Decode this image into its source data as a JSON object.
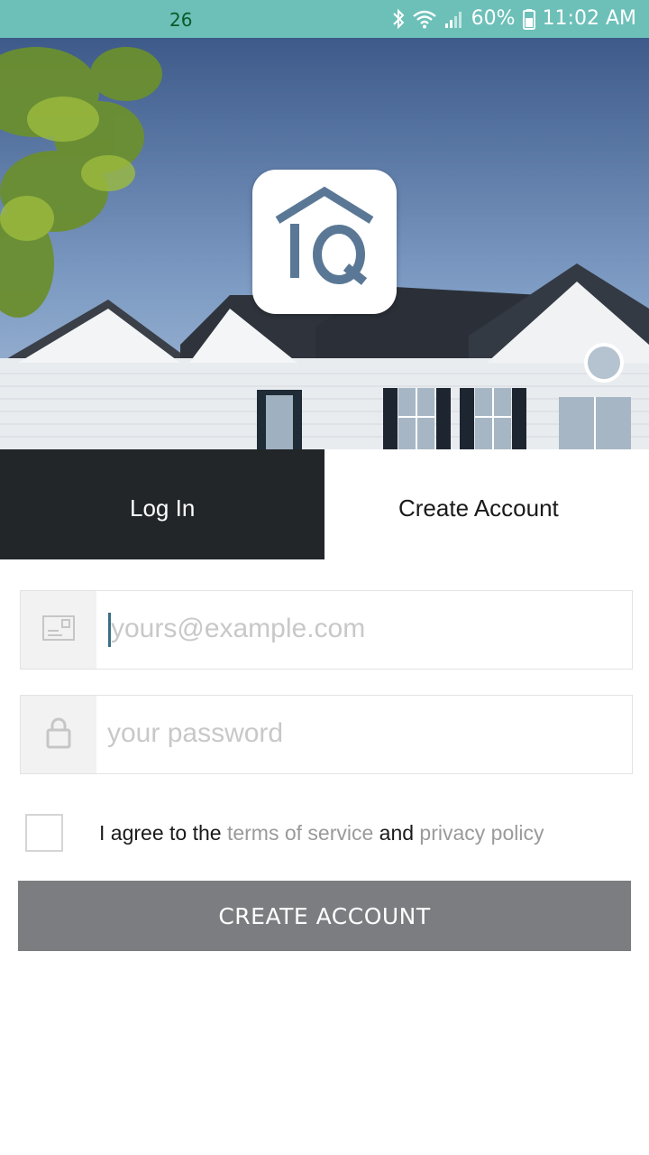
{
  "status_bar": {
    "left_text": "26",
    "battery": "60%",
    "time": "11:02 AM",
    "icons": [
      "bluetooth-icon",
      "wifi-icon",
      "signal-icon",
      "battery-icon"
    ]
  },
  "hero": {
    "logo_icon": "iq-house-logo-icon"
  },
  "tabs": {
    "login": "Log In",
    "create": "Create Account"
  },
  "form": {
    "email": {
      "placeholder": "yours@example.com",
      "icon": "envelope-icon"
    },
    "password": {
      "placeholder": "your password",
      "icon": "lock-icon"
    },
    "terms": {
      "prefix": "I agree to the",
      "tos": "terms of service",
      "and": "and",
      "privacy": "privacy policy"
    },
    "submit": "CREATE ACCOUNT"
  },
  "colors": {
    "status_bar": "#6cc0b8",
    "tab_active_bg": "#222629",
    "button_bg": "#7b7d80",
    "logo_blue": "#5a7896"
  }
}
